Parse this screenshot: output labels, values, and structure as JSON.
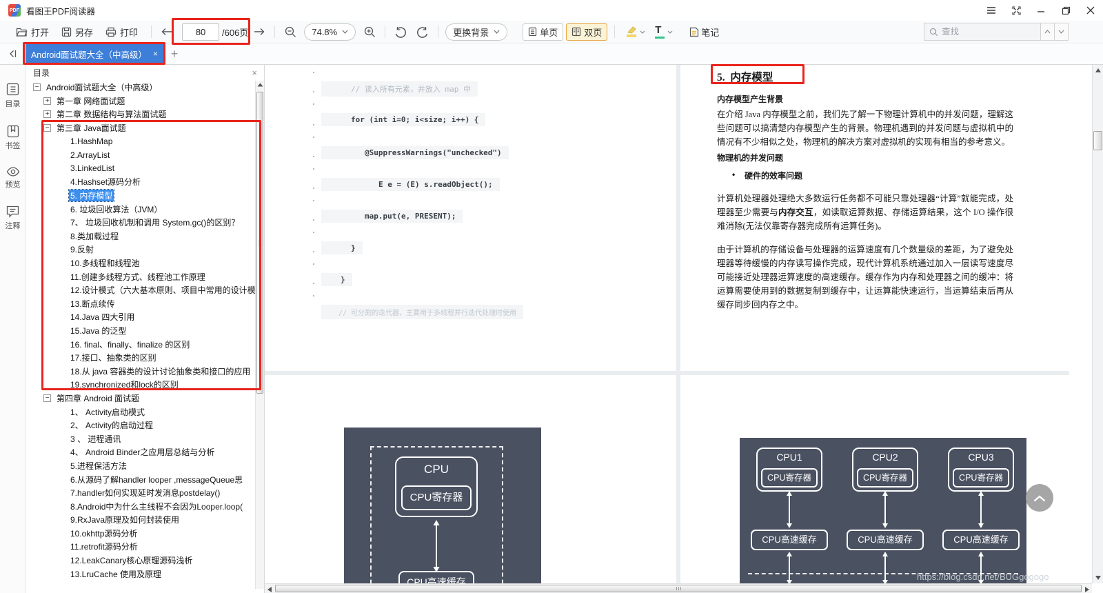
{
  "app": {
    "title": "看图王PDF阅读器",
    "logo_text": "PDF"
  },
  "toolbar": {
    "open": "打开",
    "save_as": "另存",
    "print": "打印",
    "page_current": "80",
    "page_total": "/606页",
    "zoom_level": "74.8%",
    "change_background": "更换背景",
    "single_page": "单页",
    "double_page": "双页",
    "text_tool_icon": "T",
    "notes": "笔记",
    "search_placeholder": "查找"
  },
  "tabbar": {
    "active_tab": "Android面试题大全（中高级）",
    "close_icon": "×",
    "new_tab_icon": "+"
  },
  "sidebar": {
    "items": [
      {
        "label": "目录",
        "icon": "toc-icon"
      },
      {
        "label": "书签",
        "icon": "bookmark-icon"
      },
      {
        "label": "预览",
        "icon": "preview-icon"
      },
      {
        "label": "注释",
        "icon": "annotation-icon"
      }
    ]
  },
  "toc": {
    "header": "目录",
    "close_icon": "×",
    "toggle_icons": {
      "plus": "+",
      "minus": "−"
    },
    "items": [
      {
        "label": "Android面试题大全（中高级）",
        "level": 0,
        "toggle": "minus"
      },
      {
        "label": "第一章 网络面试题",
        "level": 1,
        "toggle": "plus"
      },
      {
        "label": "第二章 数据结构与算法面试题",
        "level": 1,
        "toggle": "plus"
      },
      {
        "label": "第三章 Java面试题",
        "level": 1,
        "toggle": "minus"
      },
      {
        "label": "1.HashMap",
        "level": 2
      },
      {
        "label": "2.ArrayList",
        "level": 2
      },
      {
        "label": "3.LinkedList",
        "level": 2
      },
      {
        "label": "4.Hashset源码分析",
        "level": 2
      },
      {
        "label": "5. 内存模型",
        "level": 2,
        "selected": true
      },
      {
        "label": "6. 垃圾回收算法（JVM）",
        "level": 2
      },
      {
        "label": "7、 垃圾回收机制和调用 System.gc()的区别？",
        "level": 2
      },
      {
        "label": "8.类加载过程",
        "level": 2
      },
      {
        "label": "9.反射",
        "level": 2
      },
      {
        "label": "10.多线程和线程池",
        "level": 2
      },
      {
        "label": "11.创建多线程方式、线程池工作原理",
        "level": 2
      },
      {
        "label": "12.设计模式（六大基本原则、项目中常用的设计模",
        "level": 2
      },
      {
        "label": "13.断点续传",
        "level": 2
      },
      {
        "label": "14.Java 四大引用",
        "level": 2
      },
      {
        "label": "15.Java 的泛型",
        "level": 2
      },
      {
        "label": "16. final、finally、finalize 的区别",
        "level": 2
      },
      {
        "label": "17.接口、抽象类的区别",
        "level": 2
      },
      {
        "label": "18.从 java 容器类的设计讨论抽象类和接口的应用",
        "level": 2
      },
      {
        "label": "19.synchronized和lock的区别",
        "level": 2
      },
      {
        "label": "第四章 Android 面试题",
        "level": 1,
        "toggle": "minus"
      },
      {
        "label": "1、 Activity启动模式",
        "level": 2
      },
      {
        "label": "2、 Activity的启动过程",
        "level": 2
      },
      {
        "label": "3 、 进程通讯",
        "level": 2
      },
      {
        "label": "4、 Android Binder之应用层总结与分析",
        "level": 2
      },
      {
        "label": "5.进程保活方法",
        "level": 2
      },
      {
        "label": "6.从源码了解handler looper ,messageQueue思",
        "level": 2
      },
      {
        "label": "7.handler如何实现延时发消息postdelay()",
        "level": 2
      },
      {
        "label": "8.Android中为什么主线程不会因为Looper.loop(",
        "level": 2
      },
      {
        "label": "9.RxJava原理及如何封装使用",
        "level": 2
      },
      {
        "label": "10.okhttp源码分析",
        "level": 2
      },
      {
        "label": "11.retrofit源码分析",
        "level": 2
      },
      {
        "label": "12.LeakCanary核心原理源码浅析",
        "level": 2
      },
      {
        "label": "13.LruCache 使用及原理",
        "level": 2
      }
    ]
  },
  "code_page": {
    "lines": [
      {
        "text": "// 读入所有元素，并放入 map 中",
        "kind": "comment"
      },
      {
        "text": "for (int i=0; i<size; i++) {",
        "kind": "code"
      },
      {
        "text": "@SuppressWarnings(\"unchecked\")",
        "kind": "code"
      },
      {
        "text": "E e = (E) s.readObject();",
        "kind": "code"
      },
      {
        "text": "map.put(e, PRESENT);",
        "kind": "code"
      },
      {
        "text": "}",
        "kind": "code"
      },
      {
        "text": "}",
        "kind": "code"
      },
      {
        "text": "// 可分割的迭代器，主要用于多线程并行迭代处理时使用",
        "kind": "comment2"
      }
    ]
  },
  "text_page": {
    "heading": "5.  内存模型",
    "sub1": "内存模型产生背景",
    "para1": "在介绍 Java 内存模型之前，我们先了解一下物理计算机中的并发问题，理解这些问题可以搞清楚内存模型产生的背景。物理机遇到的并发问题与虚拟机中的情况有不少相似之处，物理机的解决方案对虚拟机的实现有相当的参考意义。",
    "sub2": "物理机的并发问题",
    "bullet1": "硬件的效率问题",
    "para2_pre": "计算机处理器处理绝大多数运行任务都不可能只靠处理器“计算”就能完成，处理器至少需要与",
    "para2_bold": "内存交互",
    "para2_post": "，如读取运算数据、存储运算结果，这个 I/O 操作很难消除(无法仅靠寄存器完成所有运算任务)。",
    "para3": "由于计算机的存储设备与处理器的运算速度有几个数量级的差距，为了避免处理器等待缓慢的内存读写操作完成，现代计算机系统通过加入一层读写速度尽可能接近处理器运算速度的高速缓存。缓存作为内存和处理器之间的缓冲：将运算需要使用到的数据复制到缓存中，让运算能快速运行，当运算结束后再从缓存同步回内存之中。"
  },
  "diagram_single": {
    "cpu": "CPU",
    "register": "CPU寄存器",
    "cache": "CPU高速缓存"
  },
  "diagram_multi": {
    "cpus": [
      {
        "name": "CPU1",
        "register": "CPU寄存器",
        "cache": "CPU高速缓存"
      },
      {
        "name": "CPU2",
        "register": "CPU寄存器",
        "cache": "CPU高速缓存"
      },
      {
        "name": "CPU3",
        "register": "CPU寄存器",
        "cache": "CPU高速缓存"
      }
    ]
  },
  "watermark": "https://blog.csdn.net/BUGgogogo",
  "colors": {
    "tab_blue": "#3d7ed8",
    "selection_blue": "#3d8fee",
    "annotation_red": "#e8251d",
    "double_page_highlight": "#e8a33d",
    "diagram_bg": "#4a5161"
  }
}
